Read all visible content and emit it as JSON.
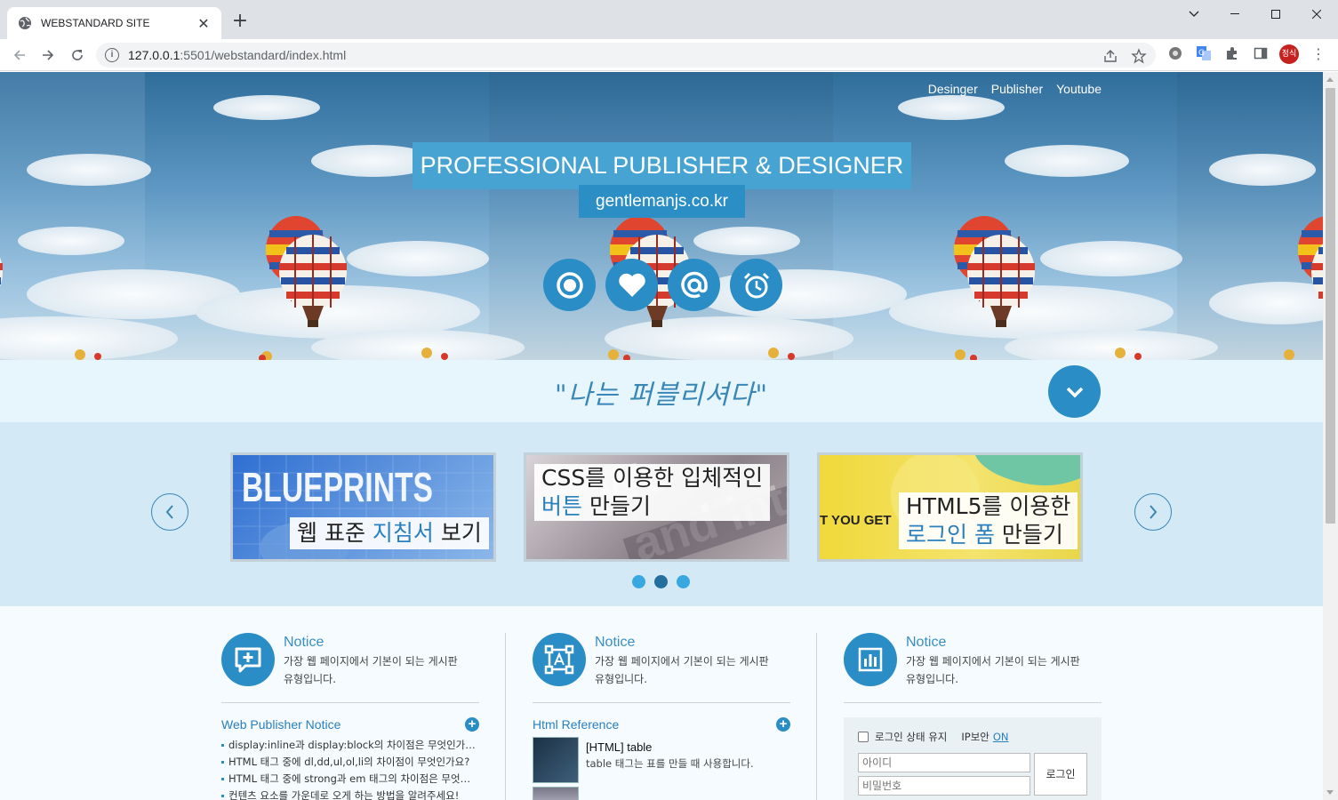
{
  "browser": {
    "tab_title": "WEBSTANDARD SITE",
    "url_host": "127.0.0.1",
    "url_rest": ":5501/webstandard/index.html",
    "profile_initials": "정식"
  },
  "hero": {
    "nav": [
      "Desinger",
      "Publisher",
      "Youtube"
    ],
    "title": "PROFESSIONAL PUBLISHER & DESIGNER",
    "subtitle": "gentlemanjs.co.kr",
    "icons": [
      "target-icon",
      "heart-icon",
      "at-icon",
      "alarm-icon"
    ]
  },
  "slogan": "\"나는 퍼블리셔다\"",
  "slider": {
    "cards": [
      {
        "brand": "BLUEPRINTS",
        "caption_pre": "웹 표준 ",
        "caption_hl": "지침서",
        "caption_post": " 보기"
      },
      {
        "caption_line1": "CSS를 이용한 입체적인",
        "caption_hl": "버튼",
        "caption_post": " 만들기"
      },
      {
        "brand": "T YOU GET",
        "caption_line1": "HTML5를 이용한",
        "caption_hl": "로그인 폼",
        "caption_post": " 만들기"
      }
    ],
    "active_dot": 1
  },
  "columns": [
    {
      "title": "Notice",
      "desc_line1": "가장 웹 페이지에서 기본이 되는 게시판",
      "desc_line2": "유형입니다.",
      "section_title": "Web Publisher Notice",
      "items": [
        "display:inline과 display:block의 차이점은 무엇인가요?",
        "HTML 태그 중에 dl,dd,ul,ol,li의 차이점이 무엇인가요?",
        "HTML 태그 중에 strong과 em 태그의 차이점은 무엇인가요?",
        "컨텐츠 요소를 가운데로 오게 하는 방법을 알려주세요!"
      ]
    },
    {
      "title": "Notice",
      "desc_line1": "가장 웹 페이지에서 기본이 되는 게시판",
      "desc_line2": "유형입니다.",
      "section_title": "Html Reference",
      "ref_title": "[HTML] table",
      "ref_desc": "table 태그는 표를 만들 때 사용합니다."
    },
    {
      "title": "Notice",
      "desc_line1": "가장 웹 페이지에서 기본이 되는 게시판",
      "desc_line2": "유형입니다.",
      "login": {
        "keep_label": "로그인 상태 유지",
        "ip_label": "IP보안",
        "ip_value": "ON",
        "id_placeholder": "아이디",
        "pw_placeholder": "비밀번호",
        "button": "로그인"
      }
    }
  ]
}
